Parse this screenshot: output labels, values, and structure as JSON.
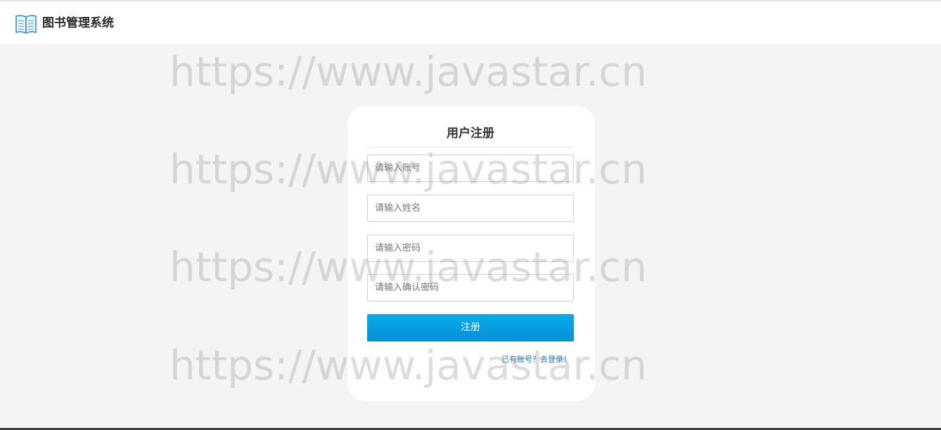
{
  "header": {
    "logo_icon": "open-book-icon",
    "brand": "图书管理系统"
  },
  "form": {
    "title": "用户注册",
    "fields": [
      {
        "placeholder": "请输入账号",
        "value": ""
      },
      {
        "placeholder": "请输入姓名",
        "value": ""
      },
      {
        "placeholder": "请输入密码",
        "value": ""
      },
      {
        "placeholder": "请输入确认密码",
        "value": ""
      }
    ],
    "submit_label": "注册",
    "login_link": "已有账号？去登录！"
  },
  "watermark": {
    "text": "https://www.javastar.cn"
  },
  "colors": {
    "accent": "#0a9fe3",
    "link": "#1e7fc0",
    "background": "#f4f4f4"
  }
}
